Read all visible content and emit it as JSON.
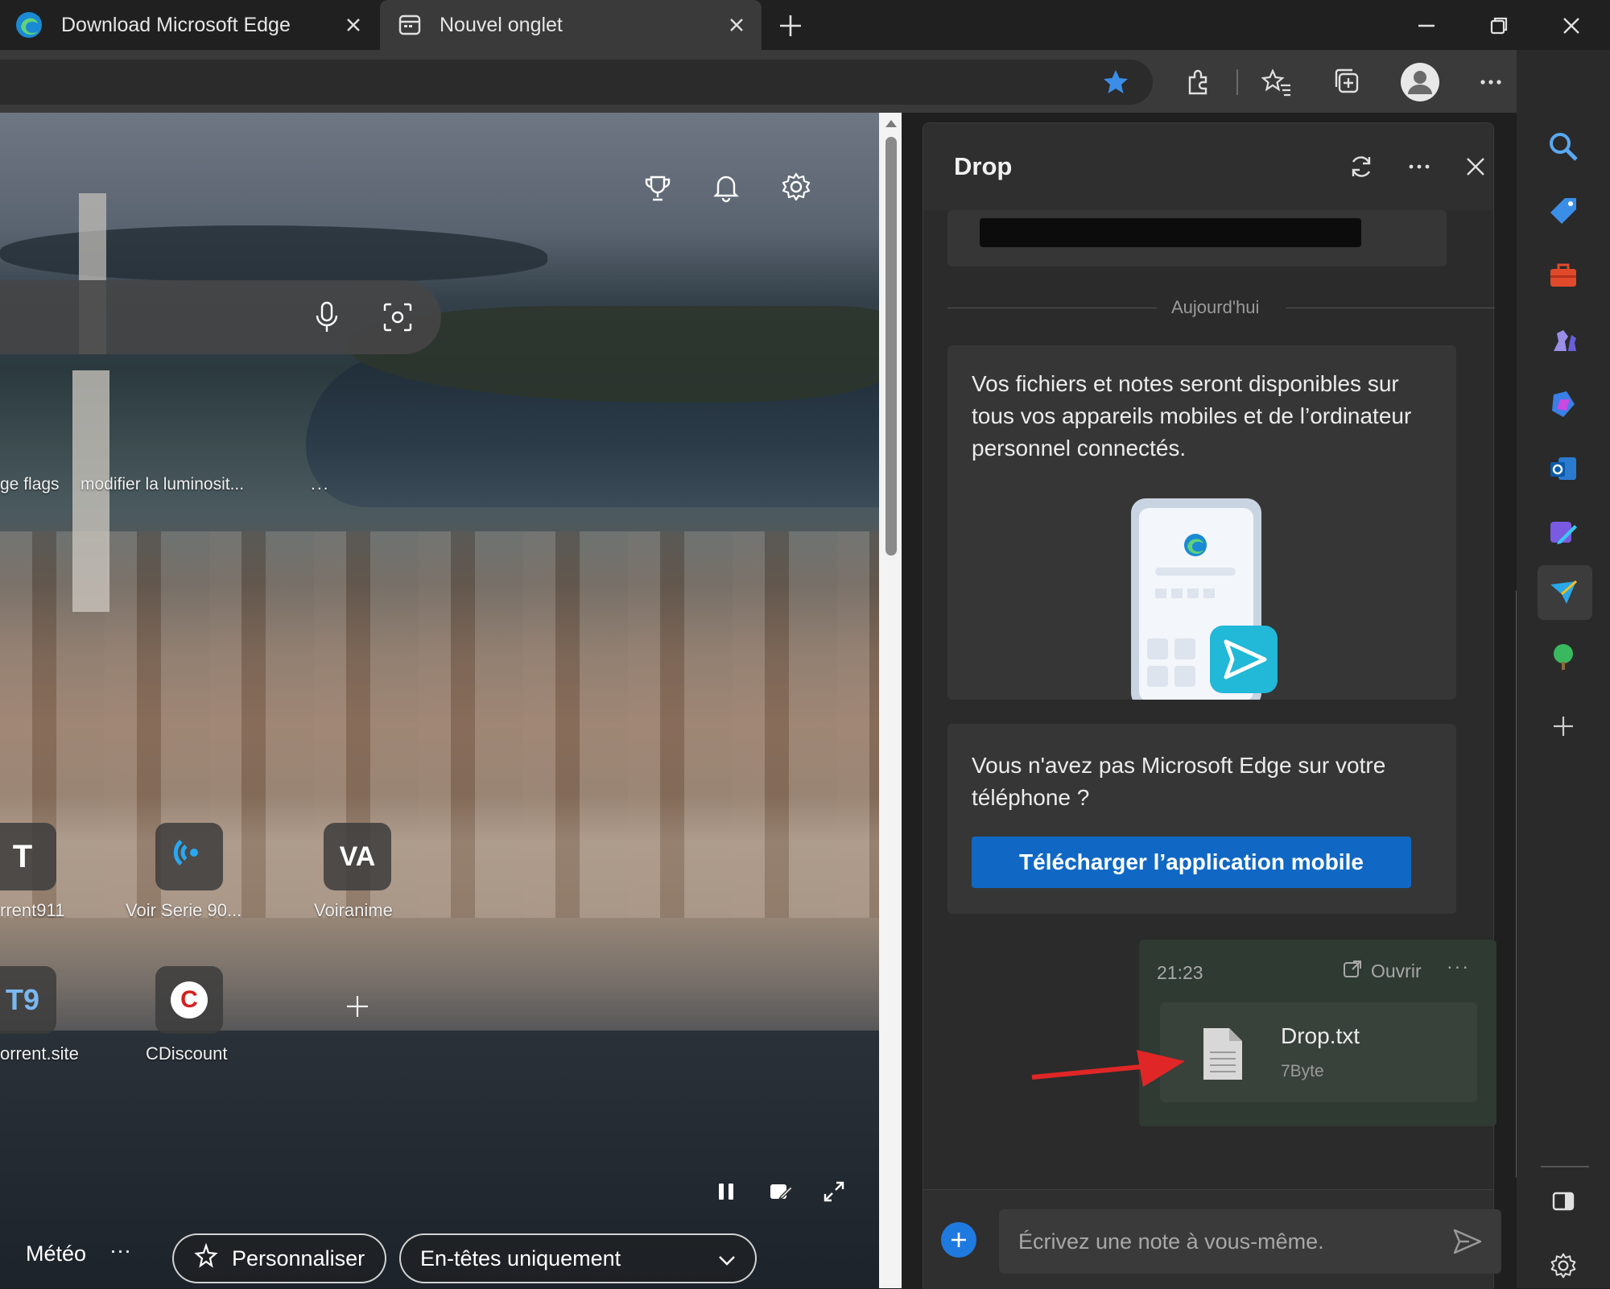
{
  "tabs": [
    {
      "title": "Download Microsoft Edge",
      "active": false
    },
    {
      "title": "Nouvel onglet",
      "active": true
    }
  ],
  "new_tab_page": {
    "quick_links": [
      "ge flags",
      "modifier la luminosit...",
      "..."
    ],
    "tiles": [
      {
        "label": "rrent911",
        "glyph": "T"
      },
      {
        "label": "Voir Serie 90...",
        "glyph": ""
      },
      {
        "label": "Voiranime",
        "glyph": "VA"
      },
      {
        "label": "orrent.site",
        "glyph": "T9"
      },
      {
        "label": "CDiscount",
        "glyph": "C"
      }
    ],
    "bottom": {
      "weather": "Météo",
      "weather_more": "···",
      "personalize": "Personnaliser",
      "headers_select": "En-têtes uniquement"
    }
  },
  "drop": {
    "title": "Drop",
    "date_divider": "Aujourd'hui",
    "info_text": "Vos fichiers et notes seront disponibles sur tous vos appareils mobiles et de l’ordinateur personnel connectés.",
    "no_edge_text": "Vous n'avez pas Microsoft Edge sur votre téléphone ?",
    "download_button": "Télécharger l’application mobile",
    "message": {
      "time": "21:23",
      "open_label": "Ouvrir",
      "more": "···",
      "file_name": "Drop.txt",
      "file_size": "7Byte"
    },
    "compose_placeholder": "Écrivez une note à vous-même."
  },
  "colors": {
    "accent_blue": "#1068c4",
    "star_blue": "#3b8ee8",
    "arrow_red": "#e02626"
  }
}
